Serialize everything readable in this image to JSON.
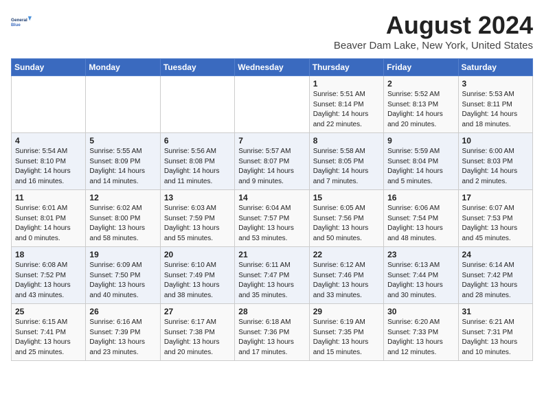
{
  "header": {
    "logo_line1": "General",
    "logo_line2": "Blue",
    "main_title": "August 2024",
    "subtitle": "Beaver Dam Lake, New York, United States"
  },
  "days_of_week": [
    "Sunday",
    "Monday",
    "Tuesday",
    "Wednesday",
    "Thursday",
    "Friday",
    "Saturday"
  ],
  "weeks": [
    [
      {
        "num": "",
        "info": ""
      },
      {
        "num": "",
        "info": ""
      },
      {
        "num": "",
        "info": ""
      },
      {
        "num": "",
        "info": ""
      },
      {
        "num": "1",
        "info": "Sunrise: 5:51 AM\nSunset: 8:14 PM\nDaylight: 14 hours\nand 22 minutes."
      },
      {
        "num": "2",
        "info": "Sunrise: 5:52 AM\nSunset: 8:13 PM\nDaylight: 14 hours\nand 20 minutes."
      },
      {
        "num": "3",
        "info": "Sunrise: 5:53 AM\nSunset: 8:11 PM\nDaylight: 14 hours\nand 18 minutes."
      }
    ],
    [
      {
        "num": "4",
        "info": "Sunrise: 5:54 AM\nSunset: 8:10 PM\nDaylight: 14 hours\nand 16 minutes."
      },
      {
        "num": "5",
        "info": "Sunrise: 5:55 AM\nSunset: 8:09 PM\nDaylight: 14 hours\nand 14 minutes."
      },
      {
        "num": "6",
        "info": "Sunrise: 5:56 AM\nSunset: 8:08 PM\nDaylight: 14 hours\nand 11 minutes."
      },
      {
        "num": "7",
        "info": "Sunrise: 5:57 AM\nSunset: 8:07 PM\nDaylight: 14 hours\nand 9 minutes."
      },
      {
        "num": "8",
        "info": "Sunrise: 5:58 AM\nSunset: 8:05 PM\nDaylight: 14 hours\nand 7 minutes."
      },
      {
        "num": "9",
        "info": "Sunrise: 5:59 AM\nSunset: 8:04 PM\nDaylight: 14 hours\nand 5 minutes."
      },
      {
        "num": "10",
        "info": "Sunrise: 6:00 AM\nSunset: 8:03 PM\nDaylight: 14 hours\nand 2 minutes."
      }
    ],
    [
      {
        "num": "11",
        "info": "Sunrise: 6:01 AM\nSunset: 8:01 PM\nDaylight: 14 hours\nand 0 minutes."
      },
      {
        "num": "12",
        "info": "Sunrise: 6:02 AM\nSunset: 8:00 PM\nDaylight: 13 hours\nand 58 minutes."
      },
      {
        "num": "13",
        "info": "Sunrise: 6:03 AM\nSunset: 7:59 PM\nDaylight: 13 hours\nand 55 minutes."
      },
      {
        "num": "14",
        "info": "Sunrise: 6:04 AM\nSunset: 7:57 PM\nDaylight: 13 hours\nand 53 minutes."
      },
      {
        "num": "15",
        "info": "Sunrise: 6:05 AM\nSunset: 7:56 PM\nDaylight: 13 hours\nand 50 minutes."
      },
      {
        "num": "16",
        "info": "Sunrise: 6:06 AM\nSunset: 7:54 PM\nDaylight: 13 hours\nand 48 minutes."
      },
      {
        "num": "17",
        "info": "Sunrise: 6:07 AM\nSunset: 7:53 PM\nDaylight: 13 hours\nand 45 minutes."
      }
    ],
    [
      {
        "num": "18",
        "info": "Sunrise: 6:08 AM\nSunset: 7:52 PM\nDaylight: 13 hours\nand 43 minutes."
      },
      {
        "num": "19",
        "info": "Sunrise: 6:09 AM\nSunset: 7:50 PM\nDaylight: 13 hours\nand 40 minutes."
      },
      {
        "num": "20",
        "info": "Sunrise: 6:10 AM\nSunset: 7:49 PM\nDaylight: 13 hours\nand 38 minutes."
      },
      {
        "num": "21",
        "info": "Sunrise: 6:11 AM\nSunset: 7:47 PM\nDaylight: 13 hours\nand 35 minutes."
      },
      {
        "num": "22",
        "info": "Sunrise: 6:12 AM\nSunset: 7:46 PM\nDaylight: 13 hours\nand 33 minutes."
      },
      {
        "num": "23",
        "info": "Sunrise: 6:13 AM\nSunset: 7:44 PM\nDaylight: 13 hours\nand 30 minutes."
      },
      {
        "num": "24",
        "info": "Sunrise: 6:14 AM\nSunset: 7:42 PM\nDaylight: 13 hours\nand 28 minutes."
      }
    ],
    [
      {
        "num": "25",
        "info": "Sunrise: 6:15 AM\nSunset: 7:41 PM\nDaylight: 13 hours\nand 25 minutes."
      },
      {
        "num": "26",
        "info": "Sunrise: 6:16 AM\nSunset: 7:39 PM\nDaylight: 13 hours\nand 23 minutes."
      },
      {
        "num": "27",
        "info": "Sunrise: 6:17 AM\nSunset: 7:38 PM\nDaylight: 13 hours\nand 20 minutes."
      },
      {
        "num": "28",
        "info": "Sunrise: 6:18 AM\nSunset: 7:36 PM\nDaylight: 13 hours\nand 17 minutes."
      },
      {
        "num": "29",
        "info": "Sunrise: 6:19 AM\nSunset: 7:35 PM\nDaylight: 13 hours\nand 15 minutes."
      },
      {
        "num": "30",
        "info": "Sunrise: 6:20 AM\nSunset: 7:33 PM\nDaylight: 13 hours\nand 12 minutes."
      },
      {
        "num": "31",
        "info": "Sunrise: 6:21 AM\nSunset: 7:31 PM\nDaylight: 13 hours\nand 10 minutes."
      }
    ]
  ]
}
